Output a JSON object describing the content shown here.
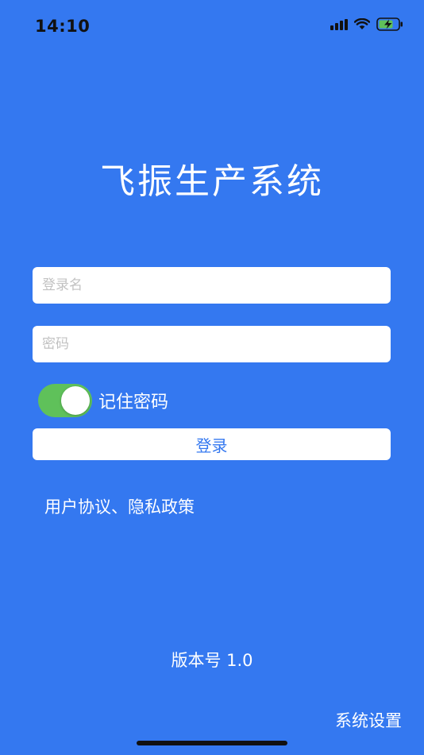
{
  "status_bar": {
    "time": "14:10"
  },
  "app": {
    "title": "飞振生产系统"
  },
  "form": {
    "username_placeholder": "登录名",
    "username_value": "",
    "password_placeholder": "密码",
    "password_value": "",
    "remember_label": "记住密码",
    "remember_checked": true,
    "login_label": "登录"
  },
  "agreement_label": "用户协议、隐私政策",
  "version_label": "版本号 1.0",
  "settings_label": "系统设置",
  "colors": {
    "background": "#3478F0",
    "toggle_on": "#5FC15A",
    "button_text": "#3478F0"
  }
}
